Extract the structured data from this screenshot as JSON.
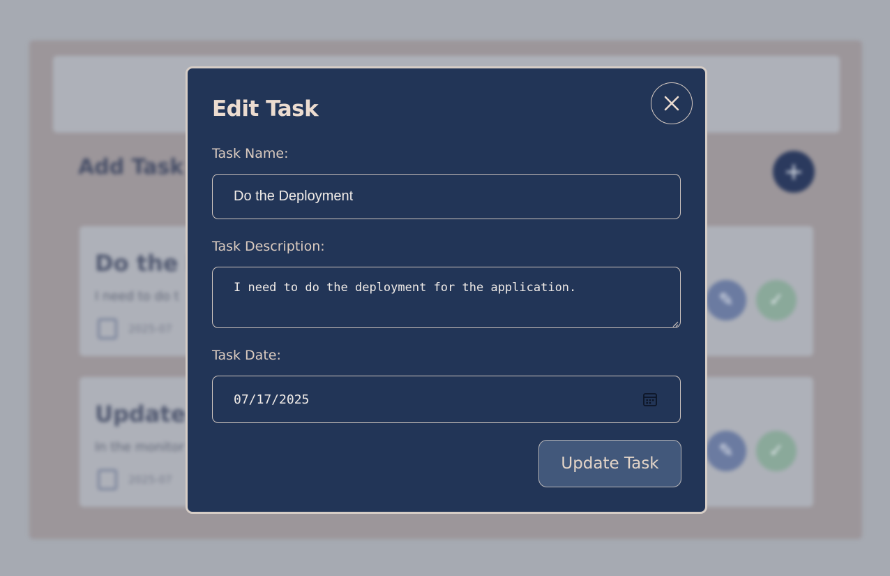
{
  "background": {
    "add_section_title": "Add Task",
    "add_button_icon": "plus-icon",
    "cards": [
      {
        "title": "Do the D",
        "description": "I need to do t",
        "date": "2025-07",
        "edit_icon": "pencil-icon",
        "done_icon": "check-icon"
      },
      {
        "title": "Update t",
        "description": "In the monitor",
        "date": "2025-07",
        "edit_icon": "pencil-icon",
        "done_icon": "check-icon"
      }
    ]
  },
  "modal": {
    "title": "Edit Task",
    "close_icon": "close-icon",
    "fields": {
      "name": {
        "label": "Task Name:",
        "value": "Do the Deployment"
      },
      "description": {
        "label": "Task Description:",
        "value": "I need to do the deployment for the application."
      },
      "date": {
        "label": "Task Date:",
        "value": "07/17/2025",
        "icon": "calendar-icon"
      }
    },
    "submit_label": "Update Task"
  },
  "colors": {
    "modal_bg": "#223557",
    "modal_border": "#d6cdc6",
    "title_text": "#ecdcd0",
    "button_bg": "#42587b",
    "overlay": "#a6aab2"
  }
}
